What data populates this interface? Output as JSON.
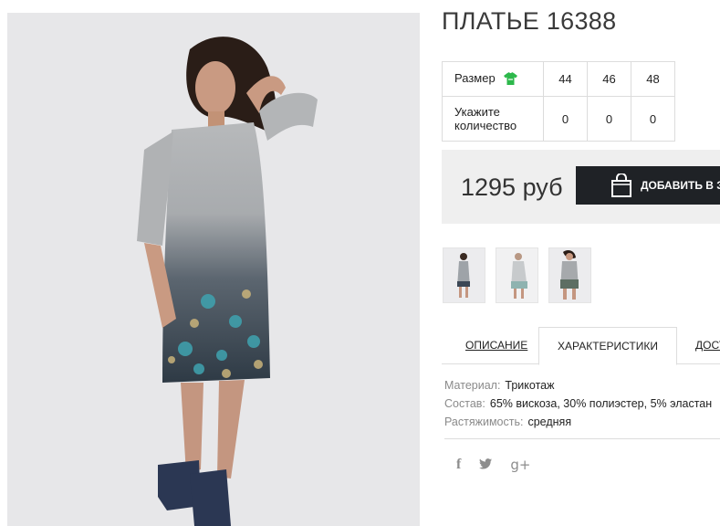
{
  "product": {
    "title": "ПЛАТЬЕ 16388",
    "price": "1295 руб",
    "add_to_cart_label": "ДОБАВИТЬ В ЗА"
  },
  "size_table": {
    "size_label": "Размер",
    "size_icon": "tshirt-icon",
    "quantity_label_line1": "Укажите",
    "quantity_label_line2": "количество",
    "sizes": [
      "44",
      "46",
      "48"
    ],
    "quantities": [
      "0",
      "0",
      "0"
    ]
  },
  "tabs": {
    "description": "ОПИСАНИЕ",
    "characteristics": "ХАРАКТЕРИСТИКИ",
    "delivery": "ДОСТ"
  },
  "specs": [
    {
      "key": "Материал:",
      "value": "Трикотаж"
    },
    {
      "key": "Состав:",
      "value": "65% вискоза, 30% полиэстер, 5% эластан"
    },
    {
      "key": "Растяжимость:",
      "value": "средняя"
    }
  ],
  "social": {
    "facebook": "f",
    "google_plus": "g+"
  },
  "colors": {
    "accent_green": "#2db84b",
    "button_dark": "#1f2226",
    "panel_gray": "#efefef"
  }
}
